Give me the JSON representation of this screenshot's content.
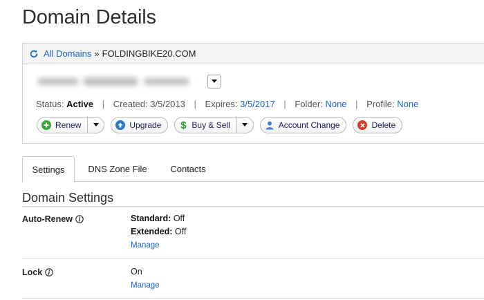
{
  "page": {
    "title": "Domain Details"
  },
  "breadcrumb": {
    "root_label": "All Domains",
    "separator": "»",
    "current": "FOLDINGBIKE20.COM"
  },
  "status": {
    "status_label": "Status:",
    "status_value": "Active",
    "created_label": "Created:",
    "created_value": "3/5/2013",
    "expires_label": "Expires:",
    "expires_value": "3/5/2017",
    "folder_label": "Folder:",
    "folder_value": "None",
    "profile_label": "Profile:",
    "profile_value": "None",
    "separator": "|"
  },
  "actions": {
    "renew": "Renew",
    "upgrade": "Upgrade",
    "buy_sell": "Buy & Sell",
    "account_change": "Account Change",
    "delete": "Delete"
  },
  "tabs": [
    {
      "label": "Settings",
      "active": true
    },
    {
      "label": "DNS Zone File",
      "active": false
    },
    {
      "label": "Contacts",
      "active": false
    }
  ],
  "section": {
    "title": "Domain Settings"
  },
  "settings": {
    "auto_renew": {
      "label": "Auto-Renew",
      "standard_label": "Standard:",
      "standard_value": "Off",
      "extended_label": "Extended:",
      "extended_value": "Off",
      "manage": "Manage"
    },
    "lock": {
      "label": "Lock",
      "value": "On",
      "manage": "Manage"
    }
  },
  "icons": {
    "refresh": "refresh-icon",
    "caret": "chevron-down-icon",
    "renew": "plus-circle-icon",
    "upgrade": "upgrade-arrow-icon",
    "buy_sell": "dollar-icon",
    "account_change": "user-icon",
    "delete": "x-circle-icon",
    "info": "info-icon"
  },
  "colors": {
    "link": "#1a62c9",
    "renew": "#3ba33b",
    "upgrade": "#2a78c8",
    "delete": "#d33b2c",
    "dollar": "#2c9a2c"
  }
}
